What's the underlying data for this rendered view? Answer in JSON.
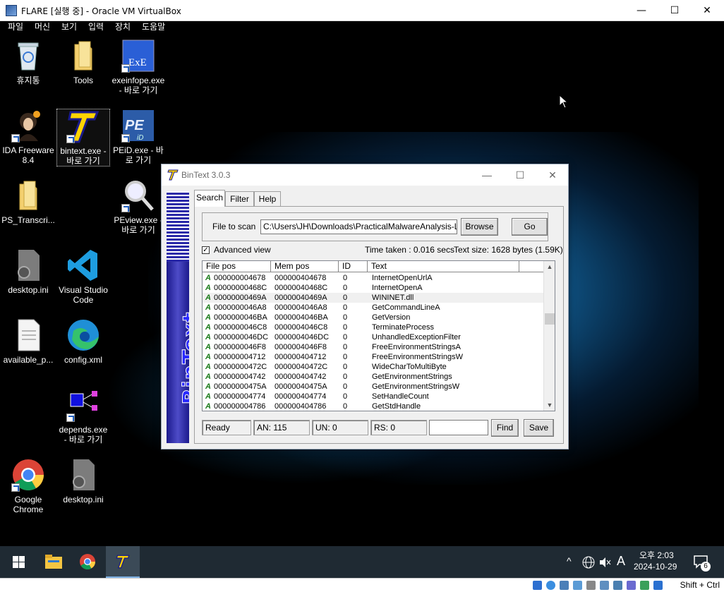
{
  "host": {
    "title": "FLARE [실행 중] - Oracle VM VirtualBox",
    "menu": [
      "파일",
      "머신",
      "보기",
      "입력",
      "장치",
      "도움말"
    ],
    "controls": {
      "minimize": "—",
      "maximize": "☐",
      "close": "✕"
    },
    "hostkey": "Shift + Ctrl"
  },
  "desktop": {
    "icons": [
      {
        "label": "휴지통"
      },
      {
        "label": "Tools"
      },
      {
        "label": "exeinfope.exe - 바로 가기"
      },
      {
        "label": "IDA Freeware 8.4"
      },
      {
        "label": "bintext.exe - 바로 가기"
      },
      {
        "label": "PEiD.exe - 바로 가기"
      },
      {
        "label": "PS_Transcri..."
      },
      {
        "label": "PEview.exe - 바로 가기"
      },
      {
        "label": "desktop.ini"
      },
      {
        "label": "Visual Studio Code"
      },
      {
        "label": "available_p..."
      },
      {
        "label": "config.xml"
      },
      {
        "label": "depends.exe - 바로 가기"
      },
      {
        "label": "Google Chrome"
      },
      {
        "label": "desktop.ini"
      }
    ]
  },
  "bintext": {
    "title": "BinText 3.0.3",
    "tabs": [
      "Search",
      "Filter",
      "Help"
    ],
    "file_to_scan_label": "File to scan",
    "file_path": "C:\\Users\\JH\\Downloads\\PracticalMalwareAnalysis-Labs-",
    "browse_label": "Browse",
    "go_label": "Go",
    "advanced_view_label": "Advanced view",
    "advanced_view_checked": true,
    "time_taken": "Time taken : 0.016 secs",
    "text_size": "Text size: 1628 bytes (1.59K)",
    "columns": [
      "File pos",
      "Mem pos",
      "ID",
      "Text"
    ],
    "rows": [
      {
        "type": "A",
        "file_pos": "000000004678",
        "mem_pos": "000000404678",
        "id": "0",
        "text": "InternetOpenUrlA"
      },
      {
        "type": "A",
        "file_pos": "00000000468C",
        "mem_pos": "00000040468C",
        "id": "0",
        "text": "InternetOpenA"
      },
      {
        "type": "A",
        "file_pos": "00000000469A",
        "mem_pos": "00000040469A",
        "id": "0",
        "text": "WININET.dll"
      },
      {
        "type": "A",
        "file_pos": "0000000046A8",
        "mem_pos": "0000004046A8",
        "id": "0",
        "text": "GetCommandLineA"
      },
      {
        "type": "A",
        "file_pos": "0000000046BA",
        "mem_pos": "0000004046BA",
        "id": "0",
        "text": "GetVersion"
      },
      {
        "type": "A",
        "file_pos": "0000000046C8",
        "mem_pos": "0000004046C8",
        "id": "0",
        "text": "TerminateProcess"
      },
      {
        "type": "A",
        "file_pos": "0000000046DC",
        "mem_pos": "0000004046DC",
        "id": "0",
        "text": "UnhandledExceptionFilter"
      },
      {
        "type": "A",
        "file_pos": "0000000046F8",
        "mem_pos": "0000004046F8",
        "id": "0",
        "text": "FreeEnvironmentStringsA"
      },
      {
        "type": "A",
        "file_pos": "000000004712",
        "mem_pos": "000000404712",
        "id": "0",
        "text": "FreeEnvironmentStringsW"
      },
      {
        "type": "A",
        "file_pos": "00000000472C",
        "mem_pos": "00000040472C",
        "id": "0",
        "text": "WideCharToMultiByte"
      },
      {
        "type": "A",
        "file_pos": "000000004742",
        "mem_pos": "000000404742",
        "id": "0",
        "text": "GetEnvironmentStrings"
      },
      {
        "type": "A",
        "file_pos": "00000000475A",
        "mem_pos": "00000040475A",
        "id": "0",
        "text": "GetEnvironmentStringsW"
      },
      {
        "type": "A",
        "file_pos": "000000004774",
        "mem_pos": "000000404774",
        "id": "0",
        "text": "SetHandleCount"
      },
      {
        "type": "A",
        "file_pos": "000000004786",
        "mem_pos": "000000404786",
        "id": "0",
        "text": "GetStdHandle"
      }
    ],
    "status": {
      "ready": "Ready",
      "an": "AN: 115",
      "un": "UN: 0",
      "rs": "RS: 0"
    },
    "find_label": "Find",
    "save_label": "Save",
    "side_brand": "BinText"
  },
  "taskbar": {
    "ime": "A",
    "time": "오후 2:03",
    "date": "2024-10-29",
    "notification_count": "6"
  }
}
